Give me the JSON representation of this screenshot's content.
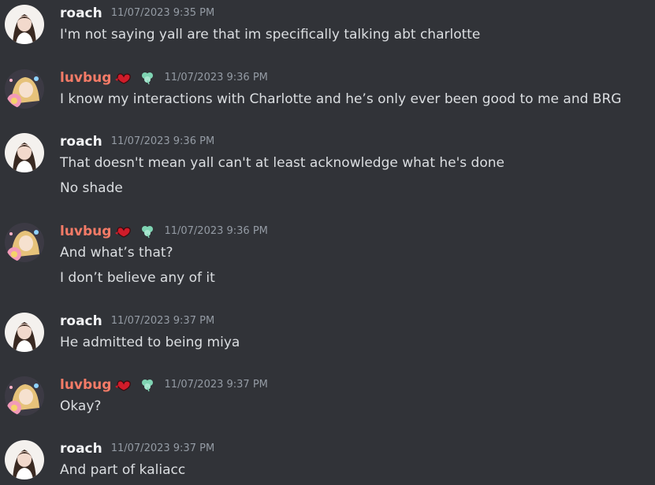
{
  "colors": {
    "background": "#313338",
    "username_roach": "#f2f3f5",
    "username_luvbug": "#f47b67",
    "timestamp": "#949ba4",
    "message_text": "#dbdee1"
  },
  "messages": [
    {
      "author": "roach",
      "timestamp": "11/07/2023 9:35 PM",
      "lines": [
        "I'm not saying yall are that im specifically talking abt charlotte"
      ]
    },
    {
      "author": "luvbug",
      "badges": [
        "heart-badge-icon",
        "clover-badge-icon"
      ],
      "timestamp": "11/07/2023 9:36 PM",
      "lines": [
        "I know my interactions with Charlotte and he’s only ever been good to me and BRG"
      ]
    },
    {
      "author": "roach",
      "timestamp": "11/07/2023 9:36 PM",
      "lines": [
        "That doesn't mean yall can't at least acknowledge what he's done",
        "No shade"
      ]
    },
    {
      "author": "luvbug",
      "badges": [
        "heart-badge-icon",
        "clover-badge-icon"
      ],
      "timestamp": "11/07/2023 9:36 PM",
      "lines": [
        "And what’s that?",
        "I don’t believe any of it"
      ]
    },
    {
      "author": "roach",
      "timestamp": "11/07/2023 9:37 PM",
      "lines": [
        "He admitted to being miya"
      ]
    },
    {
      "author": "luvbug",
      "badges": [
        "heart-badge-icon",
        "clover-badge-icon"
      ],
      "timestamp": "11/07/2023 9:37 PM",
      "lines": [
        "Okay?"
      ]
    },
    {
      "author": "roach",
      "timestamp": "11/07/2023 9:37 PM",
      "lines": [
        "And part of kaliacc"
      ]
    }
  ]
}
